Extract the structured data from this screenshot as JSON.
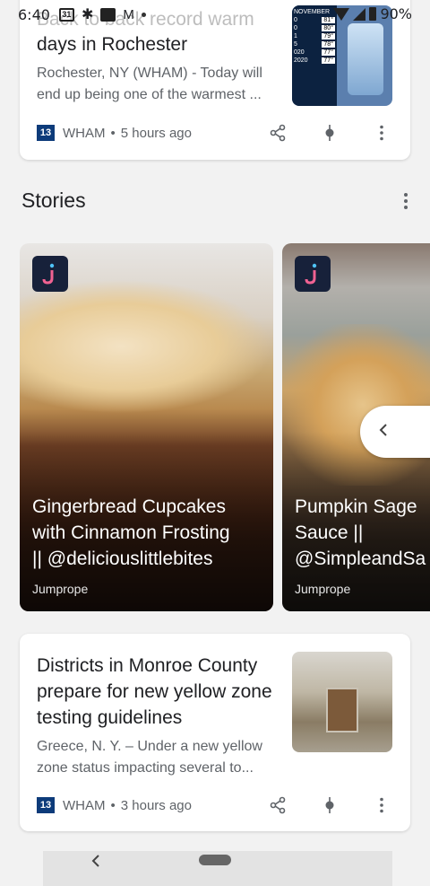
{
  "status_bar": {
    "time": "6:40",
    "calendar_day": "31",
    "battery": "90%"
  },
  "article1": {
    "faded_text": "Back to back record warm",
    "headline": "days in Rochester",
    "snippet": "Rochester, NY (WHAM) - Today will end up being one of the warmest ...",
    "source": "WHAM",
    "time": "5 hours ago",
    "thumb_title": "NOVEMBER",
    "thumb_rows": [
      {
        "year": "0",
        "temp": "81°"
      },
      {
        "year": "0",
        "temp": "80°"
      },
      {
        "year": "1",
        "temp": "79°"
      },
      {
        "year": "5",
        "temp": "78°"
      },
      {
        "year": "020",
        "temp": "77°"
      },
      {
        "year": "2020",
        "temp": "77°"
      }
    ]
  },
  "stories": {
    "title": "Stories",
    "items": [
      {
        "title": "Gingerbread Cupcakes\nwith Cinnamon Frosting\n|| @deliciouslittlebites",
        "source": "Jumprope"
      },
      {
        "title": "Pumpkin Sage\nSauce ||\n@SimpleandSa",
        "source": "Jumprope"
      }
    ]
  },
  "article2": {
    "headline": "Districts in Monroe County prepare for new yellow zone testing guidelines",
    "snippet": "Greece, N. Y. – Under a new yellow zone status impacting several to...",
    "source": "WHAM",
    "time": "3 hours ago"
  },
  "source_logo": "13",
  "separator": "•",
  "colors": {
    "card_bg": "#ffffff",
    "page_bg": "#f2f2f2",
    "wham_blue": "#0d3b7a",
    "jumprope_bg": "#17213a"
  }
}
